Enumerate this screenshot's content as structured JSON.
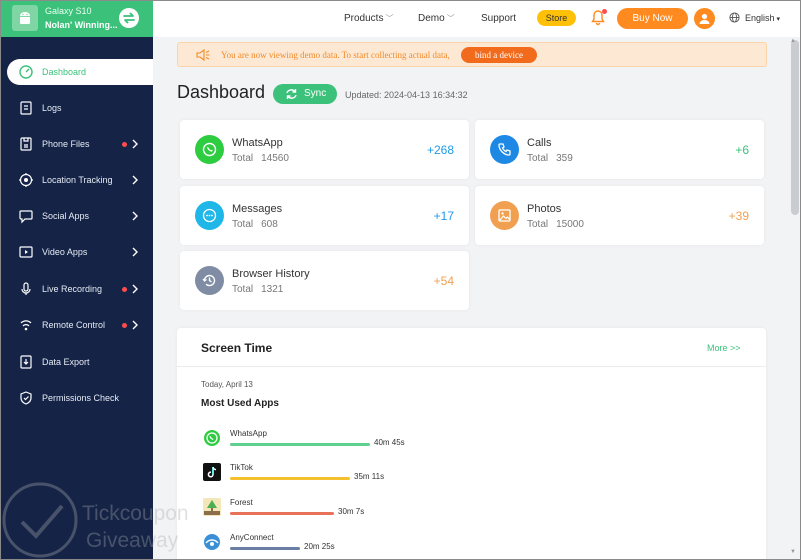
{
  "device": {
    "name": "Galaxy S10",
    "account": "Nolan' Winning..."
  },
  "sidebar": {
    "items": [
      {
        "label": "Dashboard",
        "active": true
      },
      {
        "label": "Logs"
      },
      {
        "label": "Phone Files",
        "dot": true,
        "chevron": true
      },
      {
        "label": "Location Tracking",
        "chevron": true
      },
      {
        "label": "Social Apps",
        "chevron": true
      },
      {
        "label": "Video Apps",
        "chevron": true
      },
      {
        "label": "Live Recording",
        "dot": true,
        "chevron": true
      },
      {
        "label": "Remote Control",
        "dot": true,
        "chevron": true
      },
      {
        "label": "Data Export"
      },
      {
        "label": "Permissions Check"
      }
    ]
  },
  "topbar": {
    "nav": [
      "Products",
      "Demo",
      "Support"
    ],
    "store": "Store",
    "buy_now": "Buy Now",
    "language": "English"
  },
  "banner": {
    "text": "You are now viewing demo data. To start collecting actual data,",
    "button": "bind a device"
  },
  "header": {
    "title": "Dashboard",
    "sync_label": "Sync",
    "updated": "Updated: 2024-04-13 16:34:32"
  },
  "total_label": "Total",
  "stats": [
    {
      "name": "WhatsApp",
      "total": "14560",
      "delta": "+268",
      "icon": "whatsapp-icon",
      "color": "#2ecc40"
    },
    {
      "name": "Calls",
      "total": "359",
      "delta": "+6",
      "icon": "phone-icon",
      "color": "#1e88e5"
    },
    {
      "name": "Messages",
      "total": "608",
      "delta": "+17",
      "icon": "message-icon",
      "color": "#1fb6e8"
    },
    {
      "name": "Photos",
      "total": "15000",
      "delta": "+39",
      "icon": "photo-icon",
      "color": "#f0a050"
    },
    {
      "name": "Browser History",
      "total": "1321",
      "delta": "+54",
      "icon": "history-icon",
      "color": "#7f8ca3"
    }
  ],
  "delta_colors": {
    "whatsapp": "#1e9be8",
    "calls": "#3bc17a",
    "messages": "#1e9be8",
    "photos": "#f0a050",
    "history": "#f0a050"
  },
  "screen_time": {
    "title": "Screen Time",
    "more": "More >>",
    "date": "Today, April 13",
    "subtitle": "Most Used Apps",
    "apps": [
      {
        "name": "WhatsApp",
        "time": "40m 45s",
        "fraction": 1.0,
        "color": "#5fd08e",
        "icon": "whatsapp-icon"
      },
      {
        "name": "TikTok",
        "time": "35m 11s",
        "fraction": 0.86,
        "color": "#f5c02e",
        "icon": "tiktok-icon"
      },
      {
        "name": "Forest",
        "time": "30m 7s",
        "fraction": 0.74,
        "color": "#e8715a",
        "icon": "forest-icon"
      },
      {
        "name": "AnyConnect",
        "time": "20m 25s",
        "fraction": 0.5,
        "color": "#6a7ea3",
        "icon": "anyconnect-icon"
      }
    ]
  },
  "watermark": {
    "line1": "Tickcoupon",
    "line2": "Giveaway"
  },
  "colors": {
    "brand": "#3bc17a",
    "sidebar": "#142346",
    "accent": "#ff8a1f"
  }
}
